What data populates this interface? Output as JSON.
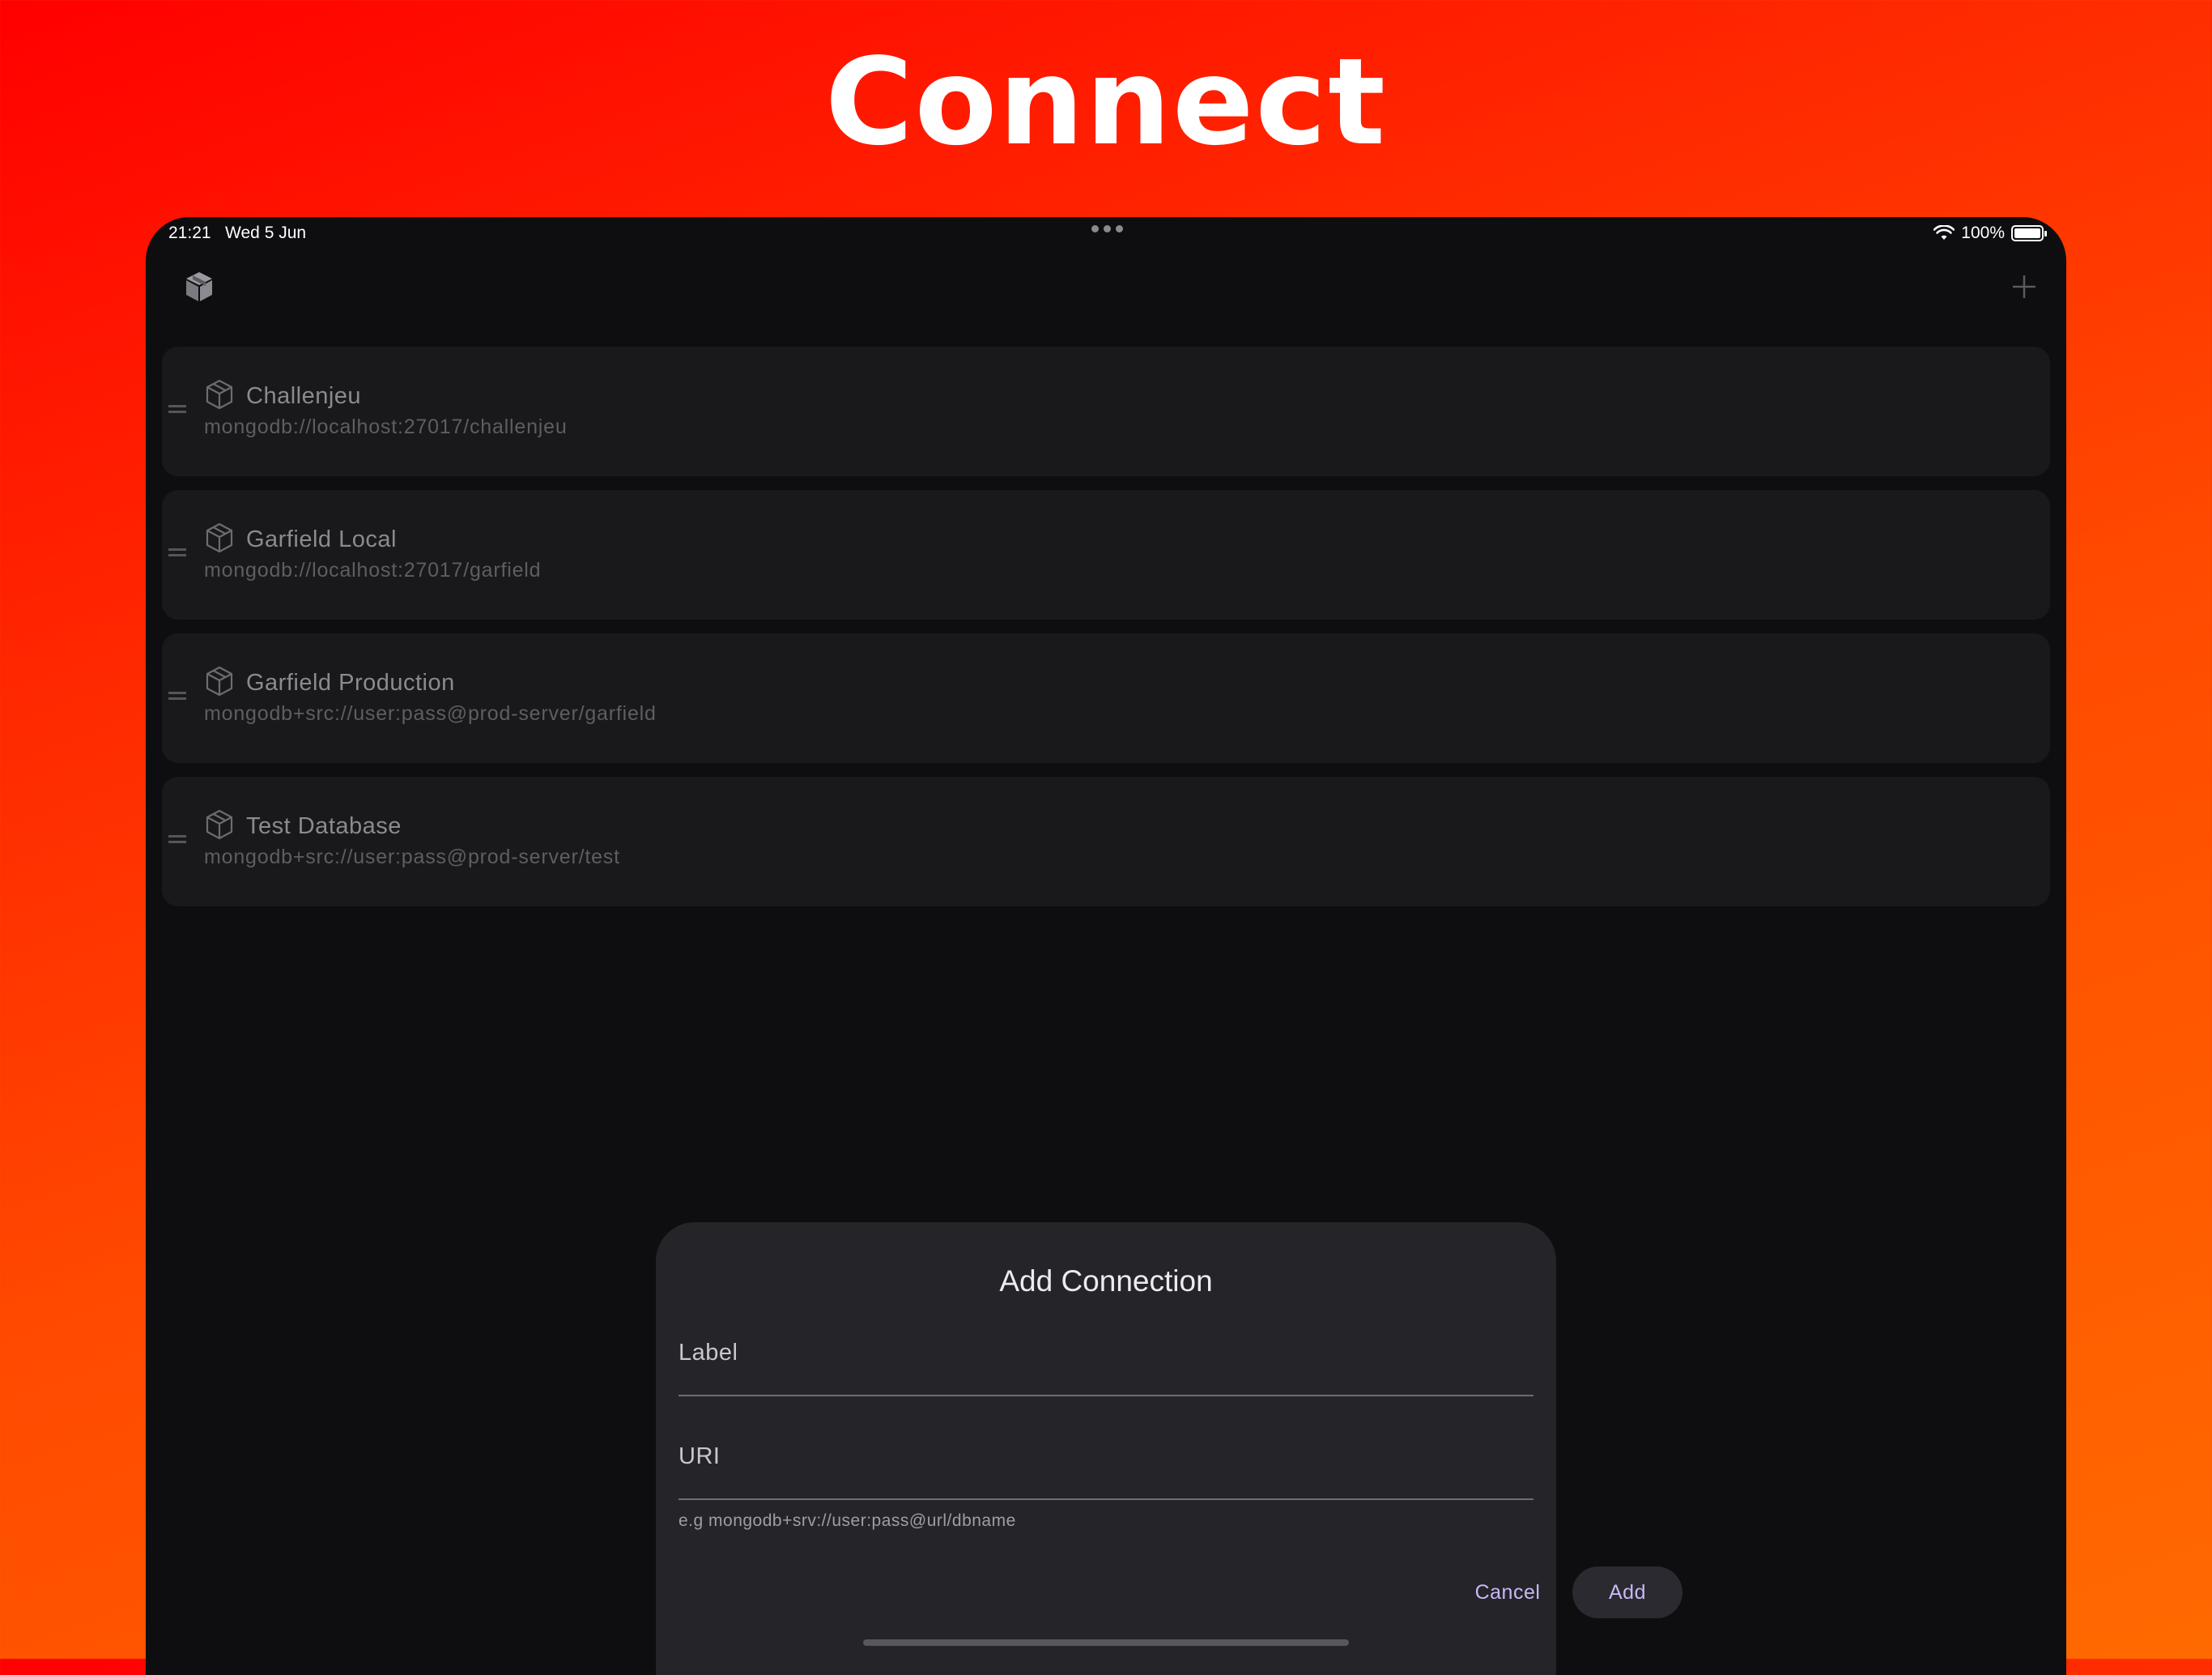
{
  "headline": "Connect",
  "status_bar": {
    "time_date": "21:21   Wed 5 Jun",
    "battery_percent": "100%",
    "battery_level": 1.0
  },
  "toolbar": {
    "app_icon": "cube-icon",
    "add_icon": "plus-icon"
  },
  "connections": [
    {
      "label": "Challenjeu",
      "uri": "mongodb://localhost:27017/challenjeu"
    },
    {
      "label": "Garfield Local",
      "uri": "mongodb://localhost:27017/garfield"
    },
    {
      "label": "Garfield Production",
      "uri": "mongodb+src://user:pass@prod-server/garfield"
    },
    {
      "label": "Test Database",
      "uri": "mongodb+src://user:pass@prod-server/test"
    }
  ],
  "dialog": {
    "title": "Add Connection",
    "label_field": "Label",
    "uri_field": "URI",
    "uri_hint": "e.g mongodb+srv://user:pass@url/dbname",
    "cancel": "Cancel",
    "add": "Add"
  },
  "colors": {
    "accent": "#c9b8f5",
    "background_gradient_top": "#ff0000",
    "background_gradient_bottom": "#ff6a00"
  }
}
